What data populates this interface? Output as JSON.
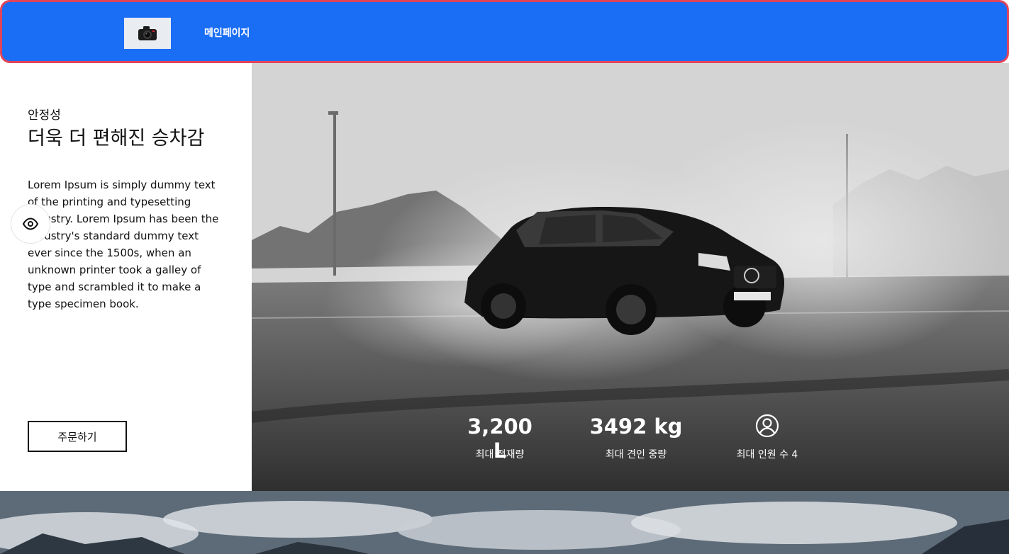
{
  "nav": {
    "logo_icon": "camera-icon",
    "link_label": "메인페이지"
  },
  "feature": {
    "eyebrow": "안정성",
    "headline": "더욱 더 편해진 승차감",
    "body": "Lorem Ipsum is simply dummy text of the printing and typesetting industry. Lorem Ipsum has been the industry's standard dummy text ever since the 1500s, when an unknown printer took a galley of type and scrambled it to make a type specimen book.",
    "order_label": "주문하기",
    "view_icon": "eye-icon"
  },
  "stats": {
    "cargo_value": "3,200 L",
    "cargo_label": "최대 적재량",
    "towing_value": "3492 kg",
    "towing_label": "최대 견인 중량",
    "passenger_icon": "user-circle-icon",
    "passenger_label": "최대 인원 수 4"
  },
  "colors": {
    "navbar": "#1a6df5",
    "navbar_border": "#e0445a"
  }
}
